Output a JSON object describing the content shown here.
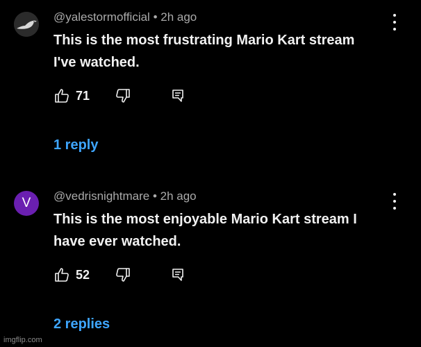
{
  "comments": [
    {
      "handle": "@yalestormofficial",
      "separator": "•",
      "time": "2h ago",
      "text": "This is the most frustrating Mario Kart stream I've watched.",
      "likes": "71",
      "replies_label": "1 reply",
      "avatar_icon": "bird-silhouette-icon"
    },
    {
      "handle": "@vedrisnightmare",
      "separator": "•",
      "time": "2h ago",
      "text": "This is the most enjoyable Mario Kart stream I have ever watched.",
      "likes": "52",
      "replies_label": "2 replies",
      "avatar_letter": "V",
      "avatar_color": "#6a1fb0"
    }
  ],
  "watermark": "imgflip.com",
  "colors": {
    "background": "#000000",
    "link": "#3ea6ff",
    "meta": "#aaaaaa",
    "text": "#f1f1f1"
  }
}
